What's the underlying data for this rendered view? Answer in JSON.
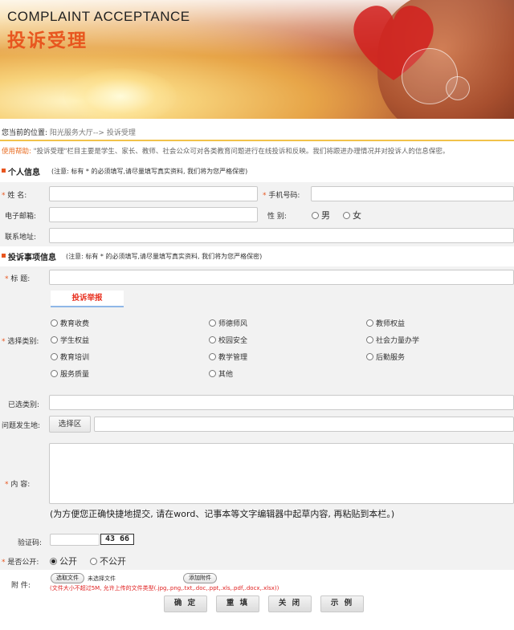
{
  "banner": {
    "title_en": "COMPLAINT ACCEPTANCE",
    "title_cn": "投诉受理"
  },
  "breadcrumb": {
    "label": "您当前的位置:",
    "path": "阳光服务大厅--> 投诉受理"
  },
  "help": {
    "key": "使用帮助:",
    "text": "\"投诉受理\"栏目主要是学生、家长、教师、社会公众可对各类教育问题进行在线投诉和反映。我们将跟进办理情况并对投诉人的信息保密。"
  },
  "personal": {
    "title": "个人信息",
    "note": "(注意: 标有 * 的必须填写,请尽量填写真实资料, 我们将为您严格保密)",
    "name_label": "姓    名:",
    "phone_label": "手机号码:",
    "email_label": "电子邮箱:",
    "gender_label": "性    别:",
    "gender_male": "男",
    "gender_female": "女",
    "address_label": "联系地址:"
  },
  "complaint": {
    "title": "投诉事项信息",
    "note": "(注意: 标有 * 的必须填写,请尽量填写真实资料, 我们将为您严格保密)",
    "subject_label": "标    题:",
    "category_tab": "投诉举报",
    "category_label": "选择类别:",
    "categories": [
      "教育收费",
      "师德师风",
      "教师权益",
      "学生权益",
      "校园安全",
      "社会力量办学",
      "教育培训",
      "教学管理",
      "后勤服务",
      "服务质量",
      "其他"
    ],
    "selected_label": "已选类别:",
    "location_label": "问题发生地:",
    "location_button": "选择区",
    "content_label": "内    容:",
    "content_hint": "(为方便您正确快捷地提交, 请在word、记事本等文字编辑器中起草内容, 再粘贴到本栏。)",
    "captcha_label": "验证码:",
    "captcha_value": "43 66",
    "public_label": "是否公开:",
    "public_yes": "公开",
    "public_no": "不公开",
    "attach_label": "附    件:",
    "choose_file": "选取文件",
    "no_file": "未选择文件",
    "add_attach": "添加附件",
    "file_note": "(文件大小不超过5M, 允许上传的文件类型(.jpg,.png,.txt,.doc,.ppt,.xls,.pdf,.docx,.xlsx))"
  },
  "actions": {
    "confirm": "确 定",
    "reset": "重 填",
    "close": "关 闭",
    "example": "示 例"
  },
  "colors": {
    "accent": "#e8561f",
    "divider": "#f1c24a"
  }
}
